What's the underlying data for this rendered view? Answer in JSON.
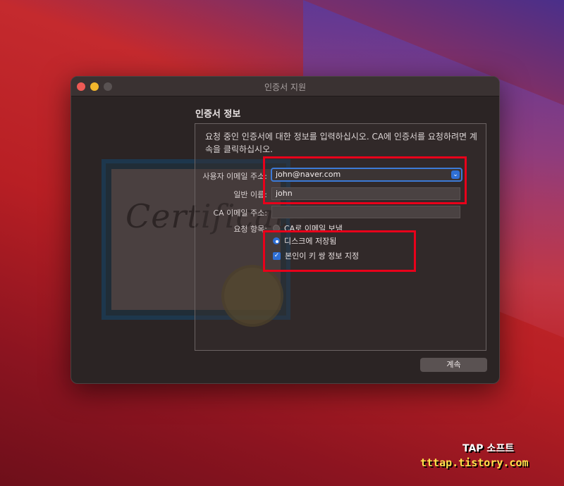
{
  "window": {
    "title": "인증서 지원"
  },
  "section_title": "인증서 정보",
  "description": "요청 중인 인증서에 대한 정보를 입력하십시오. CA에 인증서를 요청하려면 계속을 클릭하십시오.",
  "form": {
    "user_email_label": "사용자 이메일 주소:",
    "user_email_value": "john@naver.com",
    "common_name_label": "일반 이름:",
    "common_name_value": "john",
    "ca_email_label": "CA 이메일 주소:",
    "ca_email_value": "",
    "request_label": "요청 항목:",
    "request_options": [
      {
        "label": "CA로 이메일 보냄",
        "selected": false
      },
      {
        "label": "디스크에 저장됨",
        "selected": true
      }
    ],
    "keypair_label": "본인이 키 쌍 정보 지정",
    "keypair_checked": true
  },
  "continue_label": "계속",
  "background_graphic_text": "Certificate",
  "watermark": {
    "line1": "TAP 소프트",
    "line2": "tttap.tistory.com"
  },
  "colors": {
    "accent": "#2f6fd6",
    "highlight_box": "#e8001a"
  }
}
